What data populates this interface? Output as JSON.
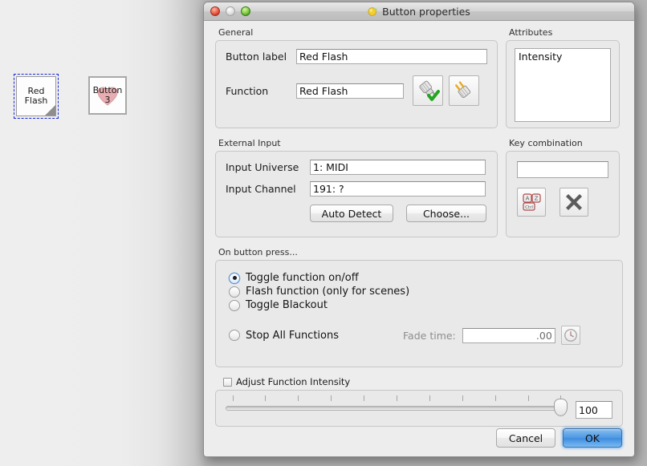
{
  "background": {
    "buttons": [
      {
        "name": "red-flash",
        "line1": "Red",
        "line2": "Flash",
        "selected": true
      },
      {
        "name": "button-3",
        "line1": "Button",
        "line2": "3",
        "selected": false
      }
    ]
  },
  "dialog": {
    "title": "Button properties",
    "window_icon": "yellow-button-icon",
    "traffic_lights": {
      "close": "close-button",
      "minimize": "minimize-button",
      "zoom": "zoom-button"
    },
    "general": {
      "title": "General",
      "button_label_label": "Button label",
      "button_label_value": "Red Flash",
      "function_label": "Function",
      "function_value": "Red Flash",
      "attach_icon": "attach-function-icon",
      "detach_icon": "detach-function-icon"
    },
    "attributes": {
      "title": "Attributes",
      "items": [
        "Intensity"
      ]
    },
    "external_input": {
      "title": "External Input",
      "universe_label": "Input Universe",
      "universe_value": "1: MIDI",
      "channel_label": "Input Channel",
      "channel_value": "191: ?",
      "auto_detect_label": "Auto Detect",
      "choose_label": "Choose..."
    },
    "key_combination": {
      "title": "Key combination",
      "value": "",
      "placeholder": "",
      "attach_icon": "keyboard-keys-icon",
      "detach_icon": "remove-x-icon"
    },
    "on_button_press": {
      "title": "On button press...",
      "options": [
        {
          "label": "Toggle function on/off",
          "checked": true
        },
        {
          "label": "Flash function (only for scenes)",
          "checked": false
        },
        {
          "label": "Toggle Blackout",
          "checked": false
        },
        {
          "label": "Stop All Functions",
          "checked": false
        }
      ],
      "fade_time_label": "Fade time:",
      "fade_time_value": ".00",
      "fade_time_enabled": false,
      "clock_icon": "clock-icon"
    },
    "intensity": {
      "checkbox_label": "Adjust Function Intensity",
      "checked": false,
      "slider_value": 100,
      "slider_min": 0,
      "slider_max": 100,
      "tick_count": 11,
      "spin_value": "100"
    },
    "footer": {
      "cancel_label": "Cancel",
      "ok_label": "OK"
    }
  },
  "colors": {
    "desktop": "#ececec",
    "dialog_bg": "#ededed",
    "accent_blue": "#4d98e3",
    "selection_dash": "#1a27d8",
    "field_bg": "#ffffff"
  }
}
